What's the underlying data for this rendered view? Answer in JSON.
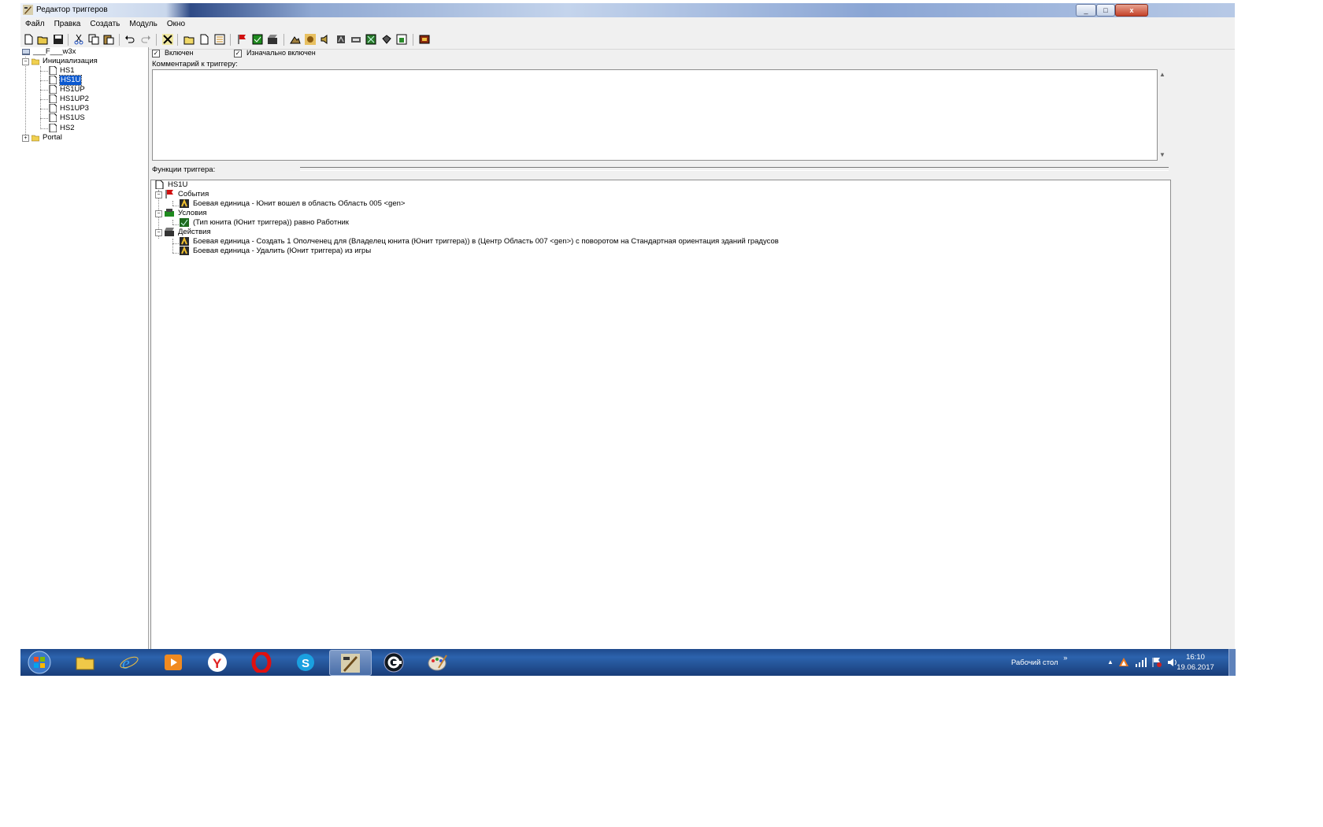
{
  "window": {
    "title": "Редактор триггеров",
    "controls": {
      "minimize": "_",
      "maximize": "□",
      "close": "x"
    }
  },
  "menu": [
    "Файл",
    "Правка",
    "Создать",
    "Модуль",
    "Окно"
  ],
  "toolbar": {
    "icons": [
      "new-icon",
      "open-icon",
      "save-icon",
      "cut-icon",
      "copy-icon",
      "paste-icon",
      "undo-icon",
      "redo-icon",
      "delete-icon",
      "new-category-icon",
      "new-trigger-icon",
      "new-comment-icon",
      "new-event-icon",
      "new-condition-icon",
      "new-action-icon",
      "terrain-editor-icon",
      "unit-editor-icon",
      "sound-editor-icon",
      "object-editor-icon",
      "camera-editor-icon",
      "region-editor-icon",
      "ai-editor-icon",
      "import-icon",
      "test-map-icon"
    ]
  },
  "tree": {
    "root": "___F___w3x",
    "categories": [
      {
        "label": "Инициализация",
        "expanded": true,
        "items": [
          "HS1",
          "HS1U",
          "HS1UP",
          "HS1UP2",
          "HS1UP3",
          "HS1US",
          "HS2"
        ],
        "selected": "HS1U"
      },
      {
        "label": "Portal",
        "expanded": false
      }
    ]
  },
  "trigger": {
    "enabled_label": "Включен",
    "enabled": true,
    "initially_on_label": "Изначально включен",
    "initially_on": true,
    "comment_label": "Комментарий к триггеру:",
    "comment_text": "",
    "functions_label": "Функции триггера:",
    "name": "HS1U",
    "events_label": "События",
    "events": [
      "Боевая единица - Юнит вошел в область Область 005 <gen>"
    ],
    "conditions_label": "Условия",
    "conditions": [
      "(Тип юнита (Юнит триггера)) равно Работник"
    ],
    "actions_label": "Действия",
    "actions": [
      "Боевая единица - Создать 1 Ополченец для (Владелец юнита (Юнит триггера)) в (Центр Область 007 <gen>) с поворотом на Стандартная ориентация зданий градусов",
      "Боевая единица - Удалить (Юнит триггера) из игры"
    ]
  },
  "taskbar": {
    "apps": [
      "explorer",
      "internet-explorer",
      "media-player",
      "yandex-browser",
      "opera",
      "skype",
      "world-editor",
      "steam-like",
      "paint"
    ],
    "active_app": "world-editor",
    "desktop_label": "Рабочий стол",
    "desktop_chevron": "»",
    "tray_arrow": "▲",
    "time": "16:10",
    "date": "19.06.2017"
  },
  "colors": {
    "selection": "#0a58d0",
    "taskbar": "#2c63ad",
    "event_flag": "#d01010",
    "condition_green": "#1e8a1e"
  }
}
